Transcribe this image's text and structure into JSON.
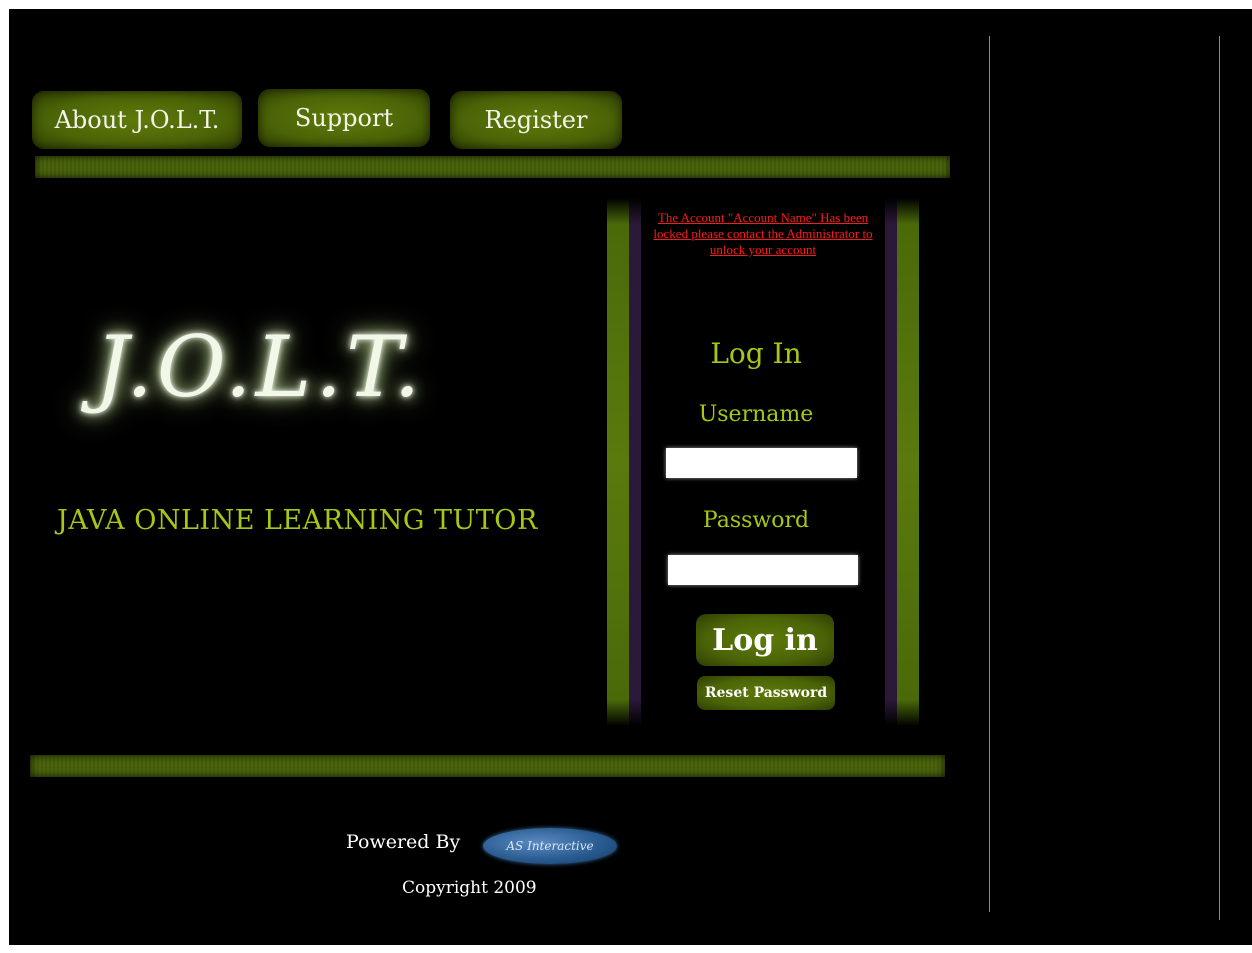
{
  "nav": {
    "about_label": "About J.O.L.T.",
    "support_label": "Support",
    "register_label": "Register"
  },
  "brand": {
    "logo_text": "J.O.L.T.",
    "tagline": "JAVA ONLINE LEARNING TUTOR"
  },
  "login": {
    "lock_message": "The Account \"Account Name\" Has been locked please contact the Administrator to unlock your account",
    "title": "Log In",
    "username_label": "Username",
    "username_value": "",
    "password_label": "Password",
    "password_value": "",
    "login_button": "Log in",
    "reset_button": "Reset Password"
  },
  "footer": {
    "powered_by": "Powered By",
    "badge_text": "AS Interactive",
    "copyright": "Copyright 2009"
  },
  "colors": {
    "accent_green": "#a6c814",
    "button_green": "#4b6407",
    "error_red": "#ff1a1a",
    "background": "#000000"
  }
}
